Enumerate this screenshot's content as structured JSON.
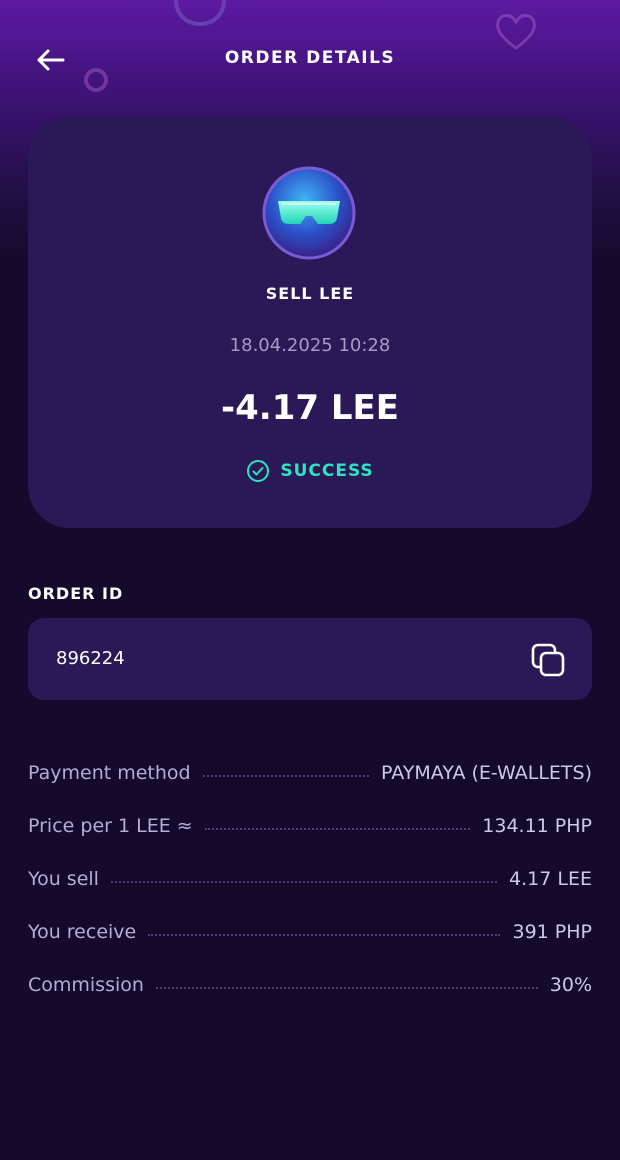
{
  "header": {
    "title": "ORDER DETAILS"
  },
  "icons": {
    "back": "arrow-left-icon",
    "token": "token-glasses-avatar",
    "status": "check-circle-icon",
    "copy": "copy-icon"
  },
  "summary": {
    "type": "SELL LEE",
    "date": "18.04.2025 10:28",
    "amount": "-4.17 LEE",
    "status": "SUCCESS"
  },
  "order": {
    "label": "ORDER ID",
    "id": "896224"
  },
  "details": [
    {
      "label": "Payment method",
      "value": "PAYMAYA (E-WALLETS)"
    },
    {
      "label": "Price per 1 LEE ≈",
      "value": "134.11 PHP"
    },
    {
      "label": "You sell",
      "value": "4.17 LEE"
    },
    {
      "label": "You receive",
      "value": "391 PHP"
    },
    {
      "label": "Commission",
      "value": "30%"
    }
  ],
  "colors": {
    "background": "#150a2b",
    "card": "#2b1856",
    "success": "#2fe3c2",
    "header_gradient_top": "#5c1aa3"
  }
}
